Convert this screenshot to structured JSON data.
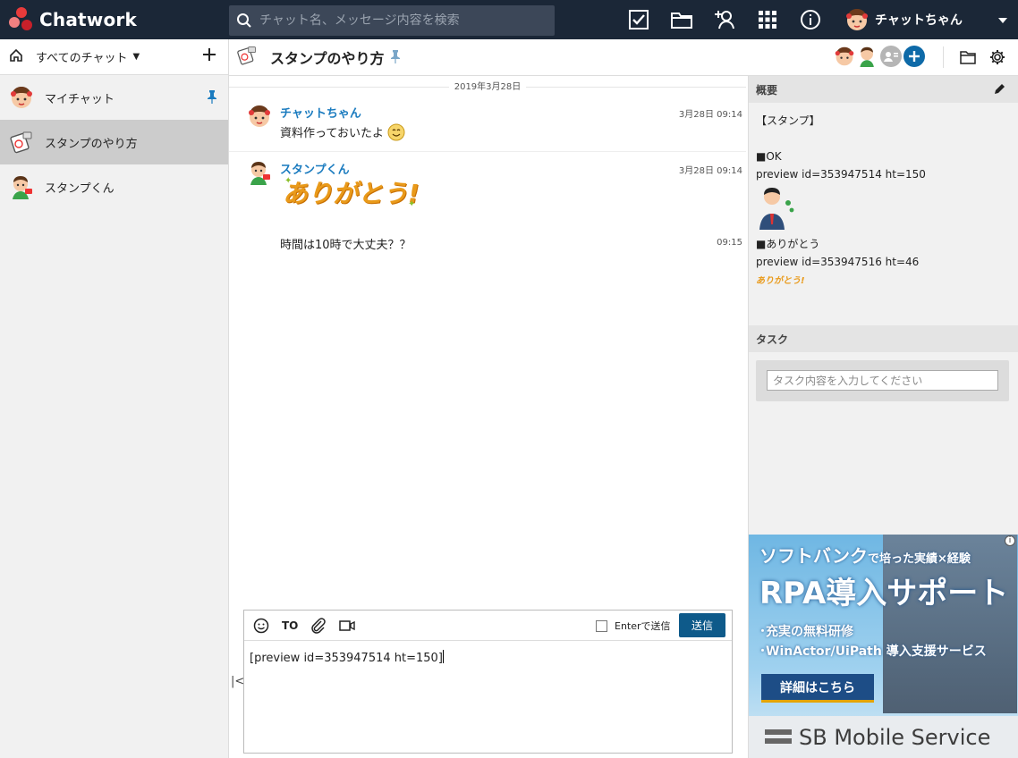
{
  "app": {
    "name": "Chatwork",
    "search_placeholder": "チャット名、メッセージ内容を検索",
    "user_name": "チャットちゃん"
  },
  "sidebar": {
    "filter_label": "すべてのチャット",
    "rooms": [
      {
        "name": "マイチャット",
        "pinned": true
      },
      {
        "name": "スタンプのやり方",
        "active": true
      },
      {
        "name": "スタンプくん"
      }
    ]
  },
  "room": {
    "title": "スタンプのやり方"
  },
  "timeline": {
    "date": "2019年3月28日",
    "messages": [
      {
        "sender": "チャットちゃん",
        "time": "3月28日 09:14",
        "text": "資料作っておいたよ"
      },
      {
        "sender": "スタンプくん",
        "time": "3月28日 09:14",
        "sticker_text": "ありがとう!"
      },
      {
        "time": "09:15",
        "text": "時間は10時で大丈夫？？"
      }
    ]
  },
  "composer": {
    "to_label": "TO",
    "enter_label": "Enterで送信",
    "send_label": "送信",
    "input_value": "[preview id=353947514 ht=150]"
  },
  "overview": {
    "title": "概要",
    "line1": "【スタンプ】",
    "ok_title": "■OK",
    "ok_code": "preview id=353947514 ht=150",
    "arigato_title": "■ありがとう",
    "arigato_code": "preview id=353947516 ht=46",
    "arigato_sticker": "ありがとう!"
  },
  "tasks": {
    "title": "タスク",
    "placeholder": "タスク内容を入力してください"
  },
  "ad": {
    "line1a": "ソフトバンク",
    "line1b": "で培った実績×経験",
    "line2": "RPA導入サポート",
    "line3": "･充実の無料研修",
    "line4": "･WinActor/UiPath 導入支援サービス",
    "cta": "詳細はこちら",
    "brand": "SB Mobile Service",
    "info": "i"
  },
  "colors": {
    "header_bg": "#1b2737",
    "accent_blue": "#1a7bbf",
    "send_button": "#0e5a8a"
  }
}
